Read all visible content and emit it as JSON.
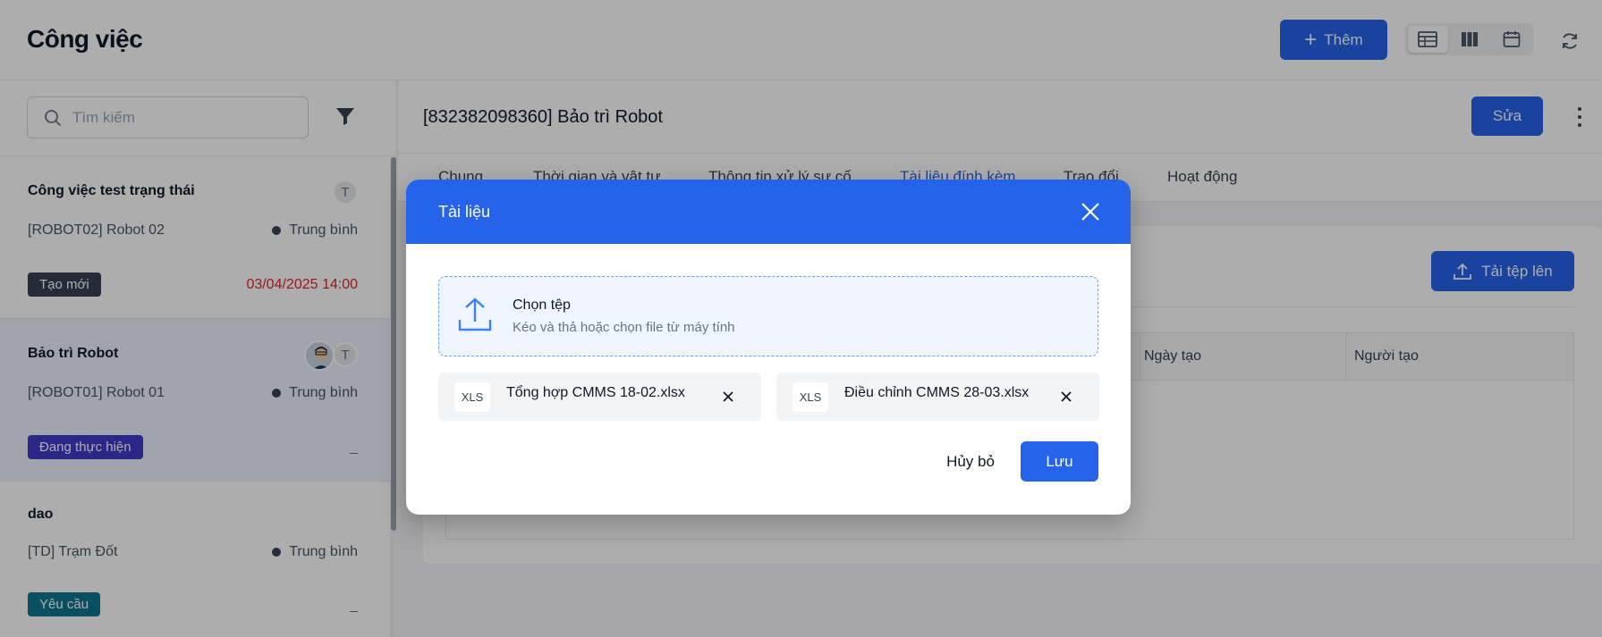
{
  "header": {
    "title": "Công việc",
    "add_label": "Thêm",
    "views": [
      "table-view-icon",
      "board-view-icon",
      "calendar-view-icon"
    ],
    "accent": "#2563eb"
  },
  "sidebar": {
    "search_placeholder": "Tìm kiếm",
    "items": [
      {
        "title": "Công việc test trạng thái",
        "asset": "[ROBOT02] Robot 02",
        "priority": "Trung bình",
        "status": "Tạo mới",
        "status_color": "#374151",
        "date": "03/04/2025 14:00",
        "avatar_initial": "T"
      },
      {
        "title": "Bảo trì Robot",
        "asset": "[ROBOT01] Robot 01",
        "priority": "Trung bình",
        "status": "Đang thực hiện",
        "status_color": "#4338ca",
        "date": "_",
        "avatar_initial": "T"
      },
      {
        "title": "dao",
        "asset": "[TD] Trạm Đốt",
        "priority": "Trung bình",
        "status": "Yêu cầu",
        "status_color": "#0e7490",
        "date": "_"
      }
    ]
  },
  "detail": {
    "title": "[832382098360] Bảo trì Robot",
    "edit_label": "Sửa",
    "tabs": [
      "Chung",
      "Thời gian và vật tư",
      "Thông tin xử lý sự cố",
      "Tài liệu đính kèm",
      "Trao đổi",
      "Hoạt động"
    ],
    "upload_label": "Tải tệp lên",
    "columns": [
      "Ngày tạo",
      "Người tạo"
    ]
  },
  "modal": {
    "title": "Tài liệu",
    "dropzone_title": "Chọn tệp",
    "dropzone_sub": "Kéo và thả hoặc chọn file từ máy tính",
    "files": [
      {
        "type": "XLS",
        "name": "Tổng hợp CMMS 18-02.xlsx"
      },
      {
        "type": "XLS",
        "name": "Điều chỉnh CMMS 28-03.xlsx"
      }
    ],
    "cancel_label": "Hủy bỏ",
    "save_label": "Lưu"
  }
}
